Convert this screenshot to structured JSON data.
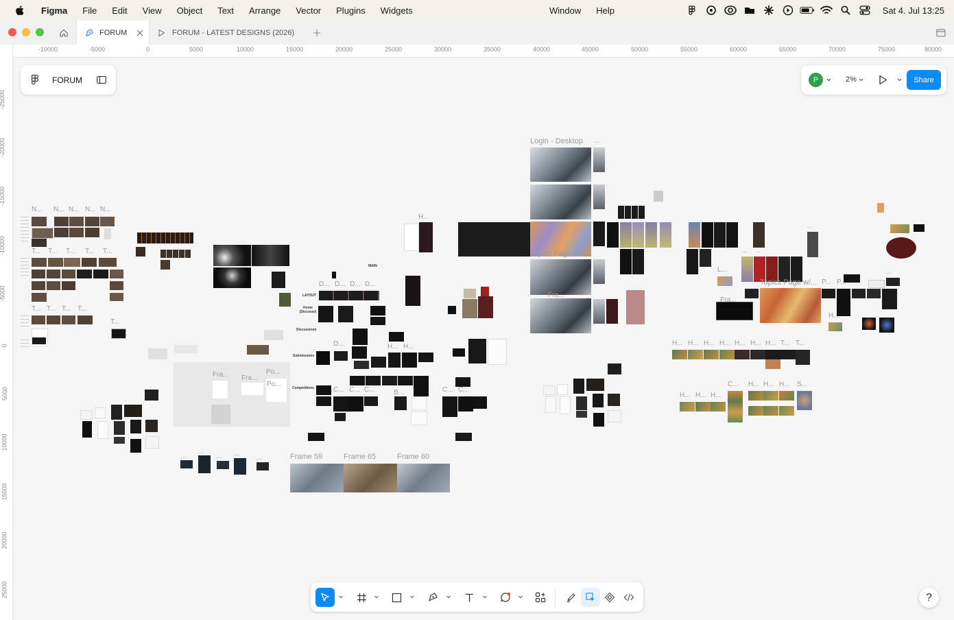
{
  "menubar": {
    "app_name": "Figma",
    "items": [
      "File",
      "Edit",
      "View",
      "Object",
      "Text",
      "Arrange",
      "Vector",
      "Plugins",
      "Widgets"
    ],
    "items_right": [
      "Window",
      "Help"
    ],
    "datetime": "Sat 4. Jul  13:25"
  },
  "tabs": {
    "active": "FORUM",
    "second": "FORUM - LATEST DESIGNS (2026)"
  },
  "ruler": {
    "x_labels": [
      "-10000",
      "-5000",
      "0",
      "5000",
      "10000",
      "15000",
      "20000",
      "25000",
      "30000",
      "35000",
      "40000",
      "45000",
      "50000",
      "55000",
      "60000",
      "65000",
      "70000",
      "75000",
      "80000"
    ],
    "y_labels": [
      "-25000",
      "-20000",
      "-15000",
      "-10000",
      "-5000",
      "0",
      "5000",
      "10000",
      "15000",
      "20000",
      "25000"
    ]
  },
  "file": {
    "name": "FORUM"
  },
  "header_right": {
    "avatar_initial": "P",
    "zoom": "2%",
    "share_label": "Share"
  },
  "canvas": {
    "labels": {
      "login_desktop": "Login - Desktop",
      "topics_page": "Topics Page w/...",
      "topics_page_2": "Topics Page w/...",
      "fra": "Fra...",
      "main": "MAIN",
      "layout": "LAYOUT",
      "home": "Home (Discover)",
      "discussions": "Discussions",
      "submissions": "Submissions",
      "competitions": "Competitions",
      "frame59": "Frame 59",
      "frame65": "Frame 65",
      "frame60": "Frame 60",
      "fra2": "Fra...",
      "po": "Po...",
      "po2": "Po...",
      "ellipsis": "...",
      "n": "N...",
      "t": "T...",
      "d": "D...",
      "h": "H...",
      "c": "C...",
      "s": "S...",
      "b": "B...",
      "p": "P...",
      "l": "L..."
    }
  },
  "help": {
    "label": "?"
  },
  "colors": {
    "accent": "#0d8bf2",
    "avatar": "#2f9e52",
    "canvas": "#f5f5f5"
  }
}
